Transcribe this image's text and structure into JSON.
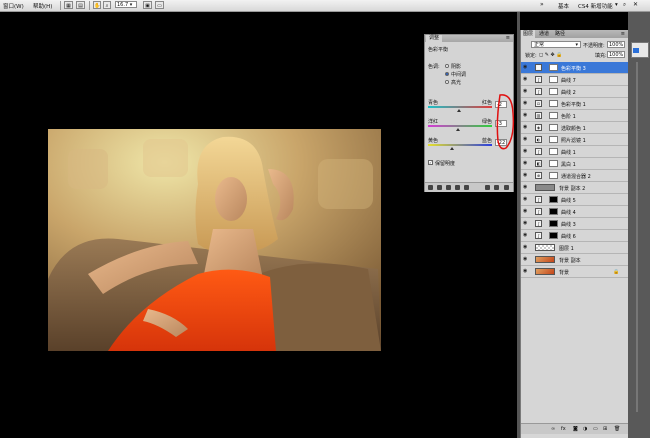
{
  "menubar": {
    "items": [
      "窗口(W)",
      "帮助(H)"
    ],
    "zoom": "16.7",
    "right": [
      "基本",
      "CS4 新增功能"
    ]
  },
  "adjustments": {
    "tab": "调整",
    "title": "色彩平衡",
    "tone_label": "色调:",
    "tones": [
      "阴影",
      "中间调",
      "高光"
    ],
    "selected_tone": "中间调",
    "sliders": [
      {
        "left": "青色",
        "right": "红色",
        "value": "-2",
        "position": 0.49,
        "gradient": [
          "#19c2c9",
          "#e23b3b"
        ]
      },
      {
        "left": "洋红",
        "right": "绿色",
        "value": "-3",
        "position": 0.485,
        "gradient": [
          "#d63ad6",
          "#2fcf3d"
        ]
      },
      {
        "left": "黄色",
        "right": "蓝色",
        "value": "-22",
        "position": 0.39,
        "gradient": [
          "#e6e02a",
          "#2a3fe0"
        ]
      }
    ],
    "preserve_luminosity": "保留明度",
    "preserve_checked": true
  },
  "layers_panel": {
    "tabs": [
      "图层",
      "通道",
      "路径"
    ],
    "blend_mode": "正常",
    "opacity_label": "不透明度:",
    "opacity": "100%",
    "lock_label": "锁定:",
    "fill_label": "填充:",
    "fill": "100%",
    "layers": [
      {
        "name": "色彩平衡 3",
        "icon": "balance-icon",
        "mask": "white",
        "selected": true
      },
      {
        "name": "曲线 7",
        "icon": "curves-icon",
        "mask": "white",
        "selected": false
      },
      {
        "name": "曲线 2",
        "icon": "curves-icon",
        "mask": "white",
        "selected": false
      },
      {
        "name": "色彩平衡 1",
        "icon": "balance-icon",
        "mask": "white",
        "selected": false
      },
      {
        "name": "色阶 1",
        "icon": "levels-icon",
        "mask": "white",
        "selected": false
      },
      {
        "name": "选取颜色 1",
        "icon": "selective-color-icon",
        "mask": "white",
        "selected": false
      },
      {
        "name": "照片滤镜 1",
        "icon": "photo-filter-icon",
        "mask": "white",
        "selected": false
      },
      {
        "name": "曲线 1",
        "icon": "curves-icon",
        "mask": "white",
        "selected": false
      },
      {
        "name": "黑白 1",
        "icon": "bw-icon",
        "mask": "white",
        "selected": false
      },
      {
        "name": "通道混合器 2",
        "icon": "mixer-icon",
        "mask": "white",
        "selected": false
      },
      {
        "name": "背景 副本 2",
        "icon": "pixel-thumb",
        "mask": "none",
        "selected": false
      },
      {
        "name": "曲线 5",
        "icon": "curves-icon",
        "mask": "black",
        "selected": false
      },
      {
        "name": "曲线 4",
        "icon": "curves-icon",
        "mask": "black",
        "selected": false
      },
      {
        "name": "曲线 3",
        "icon": "curves-icon",
        "mask": "black",
        "selected": false
      },
      {
        "name": "曲线 6",
        "icon": "curves-icon",
        "mask": "black",
        "selected": false
      },
      {
        "name": "图层 1",
        "icon": "transparent-thumb",
        "mask": "none",
        "selected": false
      },
      {
        "name": "背景 副本",
        "icon": "photo-thumb",
        "mask": "none",
        "selected": false
      },
      {
        "name": "背景",
        "icon": "photo-thumb",
        "mask": "none",
        "selected": false,
        "locked": true
      }
    ]
  }
}
